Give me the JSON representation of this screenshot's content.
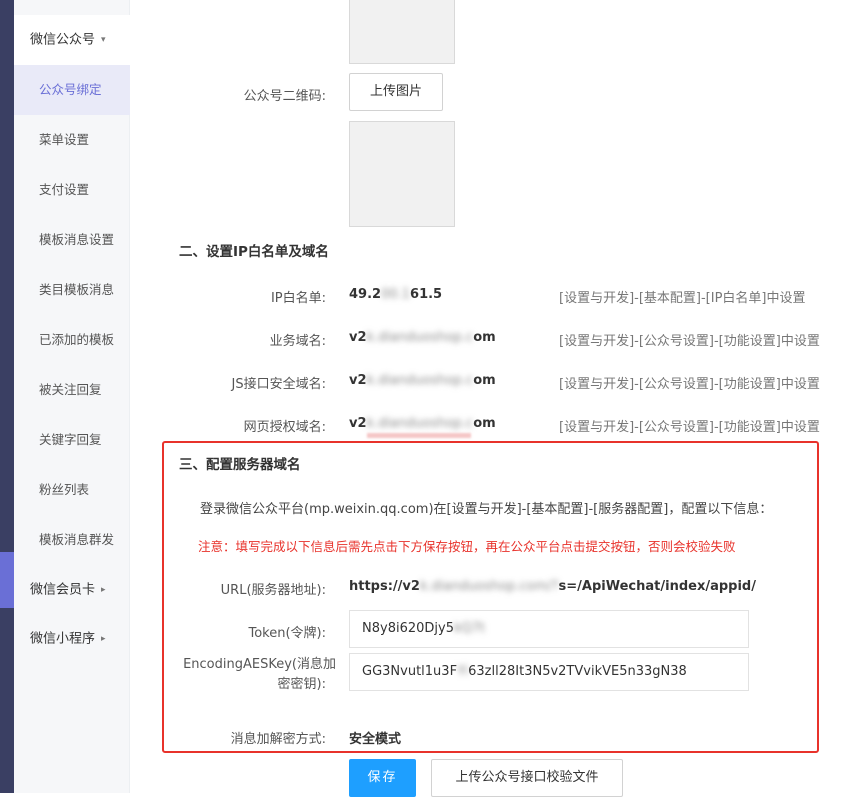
{
  "sidebar": {
    "group_wechat": "微信公众号",
    "items": [
      "公众号绑定",
      "菜单设置",
      "支付设置",
      "模板消息设置",
      "类目模板消息",
      "已添加的模板",
      "被关注回复",
      "关键字回复",
      "粉丝列表",
      "模板消息群发"
    ],
    "group_member_card": "微信会员卡",
    "group_mini_program": "微信小程序"
  },
  "qrcode": {
    "label": "公众号二维码:",
    "upload_button": "上传图片"
  },
  "section2": {
    "title": "二、设置IP白名单及域名",
    "rows": [
      {
        "label": "IP白名单:",
        "value_a": "49.2",
        "value_blur": "00.1",
        "value_b": "61.5",
        "hint": "[设置与开发]-[基本配置]-[IP白名单]中设置"
      },
      {
        "label": "业务域名:",
        "value_a": "v2",
        "value_blur": "k.dianduoshop.c",
        "value_b": "om",
        "hint": "[设置与开发]-[公众号设置]-[功能设置]中设置"
      },
      {
        "label": "JS接口安全域名:",
        "value_a": "v2",
        "value_blur": "k.dianduoshop.c",
        "value_b": "om",
        "hint": "[设置与开发]-[公众号设置]-[功能设置]中设置"
      },
      {
        "label": "网页授权域名:",
        "value_a": "v2",
        "value_blur": "k.dianduoshop.c",
        "value_b": "om",
        "hint": "[设置与开发]-[公众号设置]-[功能设置]中设置"
      }
    ]
  },
  "section3": {
    "title": "三、配置服务器域名",
    "description": "登录微信公众平台(mp.weixin.qq.com)在[设置与开发]-[基本配置]-[服务器配置]，配置以下信息：",
    "warning": "注意：填写完成以下信息后需先点击下方保存按钮，再在公众平台点击提交按钮，否则会校验失败",
    "url_label": "URL(服务器地址):",
    "url_a": "https://v2",
    "url_blur": "k.dianduoshop.com/?",
    "url_b": "s=/ApiWechat/index/appid/",
    "token_label": "Token(令牌):",
    "token_a": "N8y8i620Djy5",
    "token_blur": "kQ7t",
    "aes_label_line1": "EncodingAESKey(消息加",
    "aes_label_line2": "密密钥):",
    "aes_a": "GG3Nvutl1u3F",
    "aes_blur": "Yi",
    "aes_b": "63zll28It3N5v2TVvikVE5n33gN38",
    "mode_label": "消息加解密方式:",
    "mode_value": "安全模式"
  },
  "actions": {
    "save": "保存",
    "upload_verify": "上传公众号接口校验文件"
  }
}
